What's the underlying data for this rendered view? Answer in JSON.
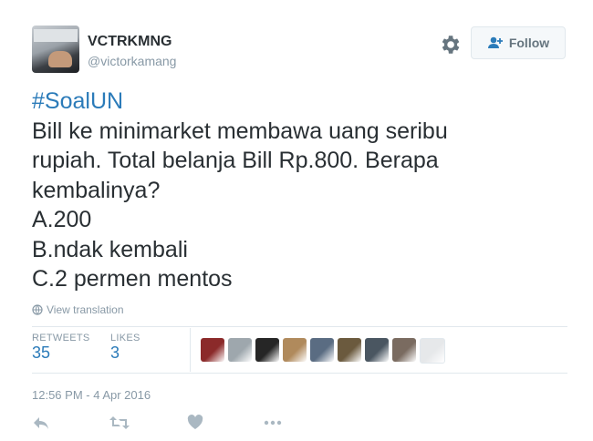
{
  "user": {
    "display_name": "VCTRKMNG",
    "handle": "@victorkamang"
  },
  "follow_button": {
    "label": "Follow"
  },
  "tweet": {
    "hashtag": "#SoalUN",
    "lines": [
      "Bill ke minimarket membawa uang seribu",
      "rupiah. Total belanja Bill Rp.800. Berapa",
      "kembalinya?",
      "A.200",
      "B.ndak kembali",
      "C.2 permen mentos"
    ]
  },
  "translate": {
    "label": "View translation",
    "icon": "globe-icon"
  },
  "stats": {
    "retweets_label": "RETWEETS",
    "retweets_value": "35",
    "likes_label": "LIKES",
    "likes_value": "3"
  },
  "likers": {
    "count": 9,
    "colors": [
      "#8b2a2a",
      "#9ea7ad",
      "#262626",
      "#b08a5c",
      "#5a6c82",
      "#6b5a3e",
      "#4a5661",
      "#7a6b60",
      "#e6e8ea"
    ]
  },
  "timestamp": "12:56 PM - 4 Apr 2016",
  "actions": {
    "reply_icon": "reply-icon",
    "retweet_icon": "retweet-icon",
    "like_icon": "heart-icon",
    "more_icon": "more-icon"
  },
  "colors": {
    "link": "#2b7bb9",
    "muted": "#8899a6",
    "text": "#292f33",
    "border": "#e1e8ed"
  }
}
